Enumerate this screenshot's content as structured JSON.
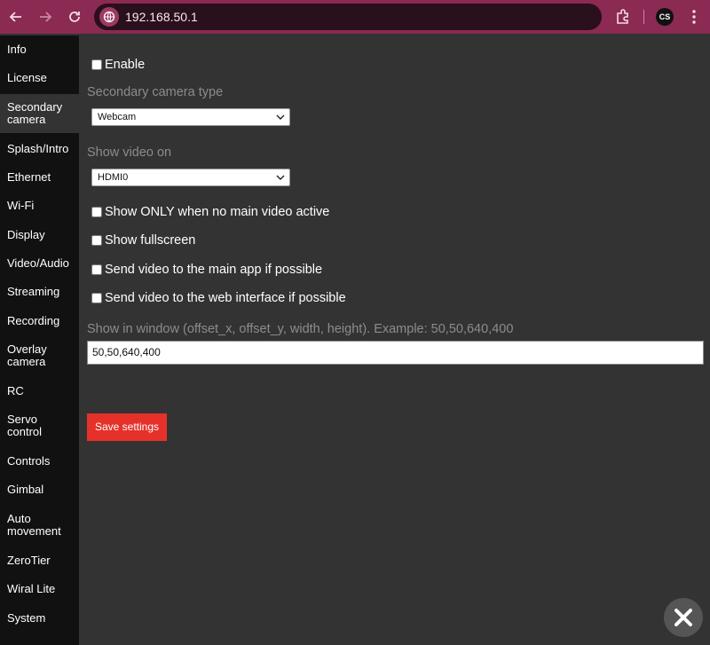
{
  "browser": {
    "url": "192.168.50.1",
    "profile_initials": "CS"
  },
  "sidebar": {
    "items": [
      {
        "label": "Info"
      },
      {
        "label": "License"
      },
      {
        "label": "Secondary\ncamera",
        "active": true
      },
      {
        "label": "Splash/Intro"
      },
      {
        "label": "Ethernet"
      },
      {
        "label": "Wi-Fi"
      },
      {
        "label": "Display"
      },
      {
        "label": "Video/Audio"
      },
      {
        "label": "Streaming"
      },
      {
        "label": "Recording"
      },
      {
        "label": "Overlay\ncamera"
      },
      {
        "label": "RC"
      },
      {
        "label": "Servo\ncontrol"
      },
      {
        "label": "Controls"
      },
      {
        "label": "Gimbal"
      },
      {
        "label": "Auto\nmovement"
      },
      {
        "label": "ZeroTier"
      },
      {
        "label": "Wiral Lite"
      },
      {
        "label": "System"
      }
    ]
  },
  "form": {
    "enable_label": "Enable",
    "camera_type_label": "Secondary camera type",
    "camera_type_value": "Webcam",
    "show_video_on_label": "Show video on",
    "show_video_on_value": "HDMI0",
    "only_when_no_main_label": "Show ONLY when no main video active",
    "fullscreen_label": "Show fullscreen",
    "send_main_app_label": "Send video to the main app if possible",
    "send_web_label": "Send video to the web interface if possible",
    "window_label": "Show in window (offset_x, offset_y, width, height). Example: 50,50,640,400",
    "window_value": "50,50,640,400",
    "save_label": "Save settings"
  },
  "colors": {
    "browser_bar": "#8b2a52",
    "sidebar_bg": "#111111",
    "content_bg": "#333333",
    "save_button": "#e6312a"
  }
}
